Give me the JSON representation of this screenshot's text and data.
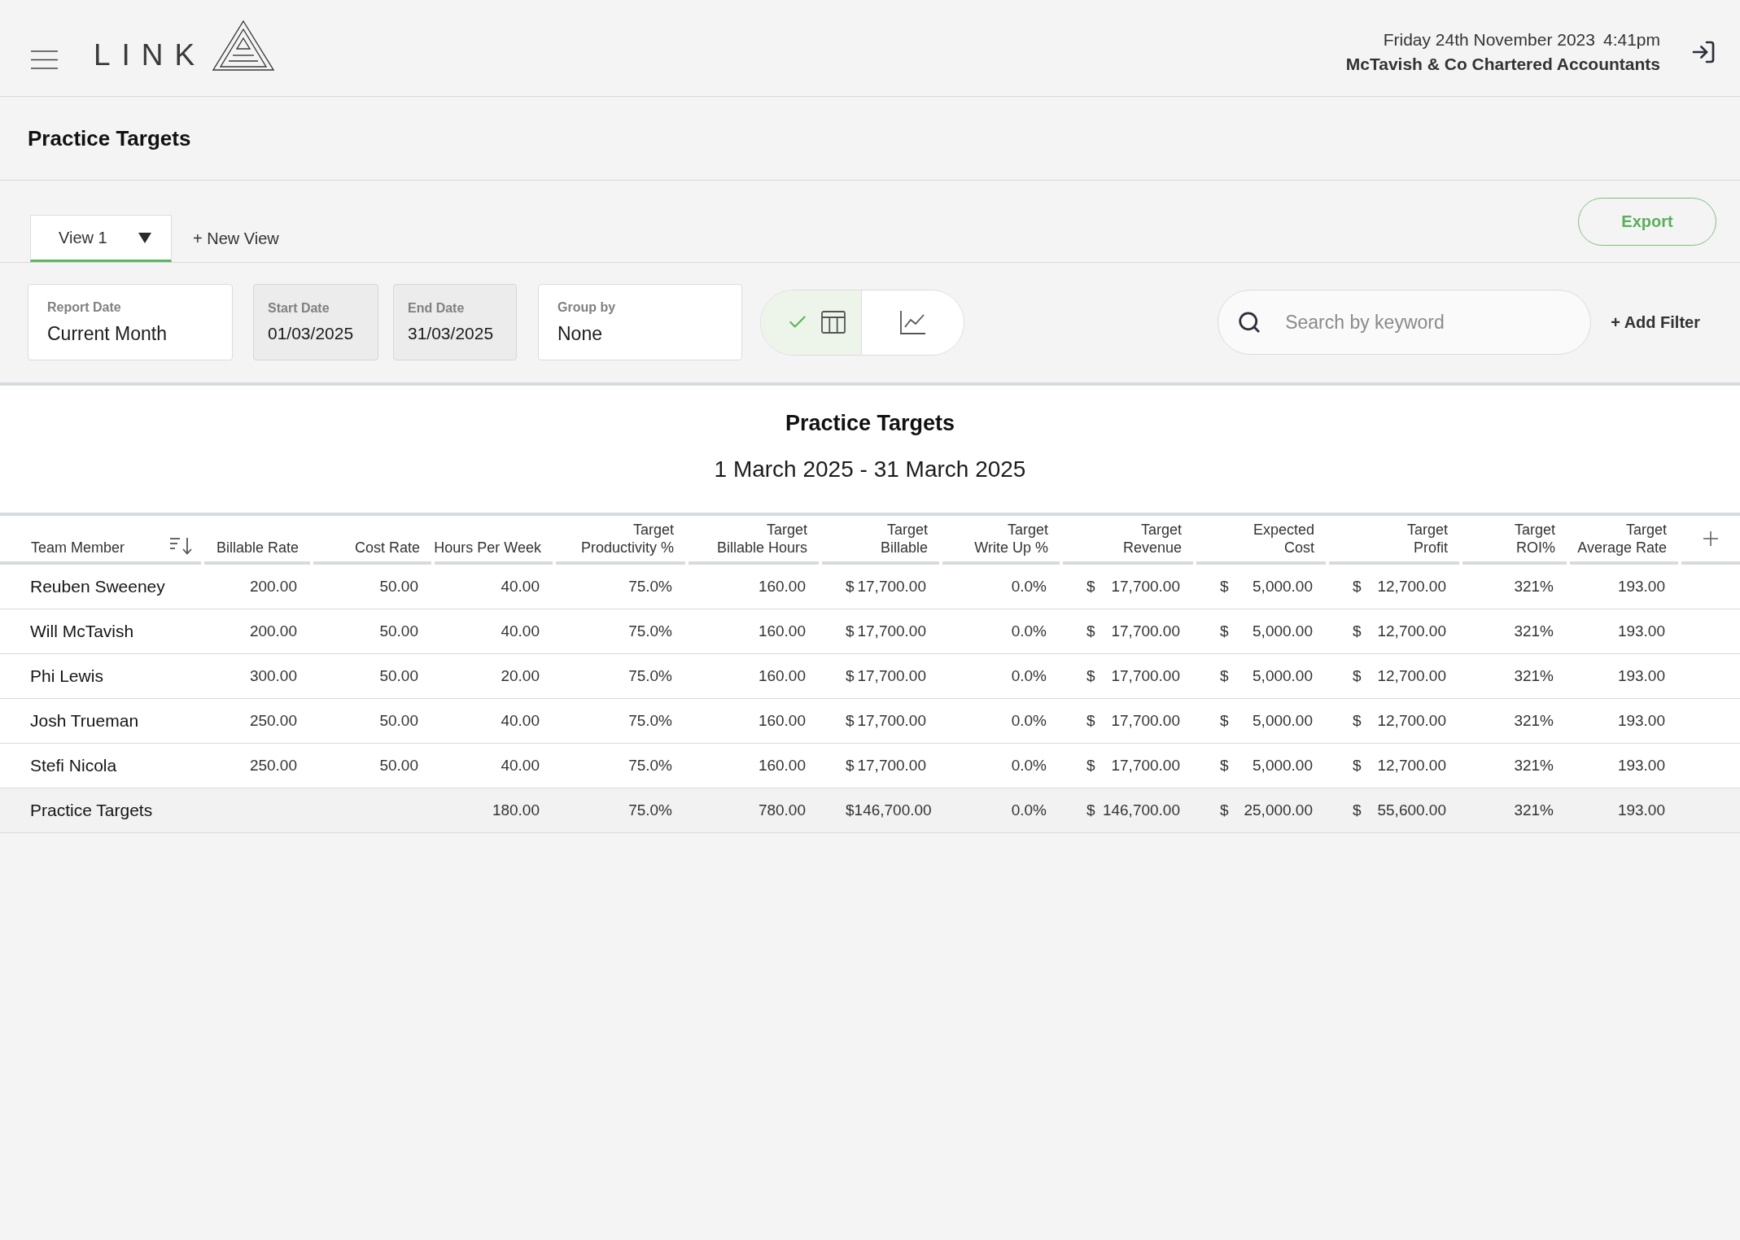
{
  "header": {
    "logo_text": "LINK",
    "date": "Friday 24th November 2023",
    "time": "4:41pm",
    "company": "McTavish & Co Chartered Accountants"
  },
  "page_title": "Practice Targets",
  "tabs": [
    {
      "label": "View 1",
      "selected": true
    }
  ],
  "new_view_button": "+ New View",
  "export_button": "Export",
  "filters": [
    {
      "label": "Report Date",
      "value": "Current Month",
      "disabled": false
    },
    {
      "label": "Start Date",
      "value": "01/03/2025",
      "disabled": true
    },
    {
      "label": "End Date",
      "value": "31/03/2025",
      "disabled": true
    },
    {
      "label": "Group by",
      "value": "None",
      "disabled": false
    }
  ],
  "view_toggle": [
    {
      "kind": "table",
      "selected": true
    },
    {
      "kind": "chart",
      "selected": false
    }
  ],
  "search": {
    "placeholder": "Search by keyword"
  },
  "add_filter_button": "+ Add Filter",
  "report": {
    "title": "Practice Targets",
    "date_range": "1 March 2025 - 31 March 2025"
  },
  "table": {
    "columns": [
      {
        "lines": [
          "Team Member"
        ],
        "kind": "name",
        "sorted": true
      },
      {
        "lines": [
          "Billable Rate"
        ],
        "kind": "number",
        "sorted": false
      },
      {
        "lines": [
          "Cost Rate"
        ],
        "kind": "number",
        "sorted": false
      },
      {
        "lines": [
          "Hours Per Week"
        ],
        "kind": "number",
        "sorted": false
      },
      {
        "lines": [
          "Target",
          "Productivity %"
        ],
        "kind": "number",
        "sorted": false
      },
      {
        "lines": [
          "Target",
          "Billable Hours"
        ],
        "kind": "number",
        "sorted": false
      },
      {
        "lines": [
          "Target",
          "Billable"
        ],
        "kind": "currency",
        "sorted": false
      },
      {
        "lines": [
          "Target",
          "Write Up %"
        ],
        "kind": "number",
        "sorted": false
      },
      {
        "lines": [
          "Target",
          "Revenue"
        ],
        "kind": "currency",
        "sorted": false
      },
      {
        "lines": [
          "Expected",
          "Cost"
        ],
        "kind": "currency",
        "sorted": false
      },
      {
        "lines": [
          "Target",
          "Profit"
        ],
        "kind": "currency",
        "sorted": false
      },
      {
        "lines": [
          "Target",
          "ROI%"
        ],
        "kind": "number",
        "sorted": false
      },
      {
        "lines": [
          "Target",
          "Average Rate"
        ],
        "kind": "number",
        "sorted": false
      }
    ],
    "rows": [
      {
        "total": false,
        "cells": [
          "Reuben Sweeney",
          "200.00",
          "50.00",
          "40.00",
          "75.0%",
          "160.00",
          {
            "symbol": "$",
            "amount": "17,700.00"
          },
          "0.0%",
          {
            "symbol": "$",
            "amount": "17,700.00"
          },
          {
            "symbol": "$",
            "amount": "5,000.00"
          },
          {
            "symbol": "$",
            "amount": "12,700.00"
          },
          "321%",
          "193.00"
        ]
      },
      {
        "total": false,
        "cells": [
          "Will McTavish",
          "200.00",
          "50.00",
          "40.00",
          "75.0%",
          "160.00",
          {
            "symbol": "$",
            "amount": "17,700.00"
          },
          "0.0%",
          {
            "symbol": "$",
            "amount": "17,700.00"
          },
          {
            "symbol": "$",
            "amount": "5,000.00"
          },
          {
            "symbol": "$",
            "amount": "12,700.00"
          },
          "321%",
          "193.00"
        ]
      },
      {
        "total": false,
        "cells": [
          "Phi Lewis",
          "300.00",
          "50.00",
          "20.00",
          "75.0%",
          "160.00",
          {
            "symbol": "$",
            "amount": "17,700.00"
          },
          "0.0%",
          {
            "symbol": "$",
            "amount": "17,700.00"
          },
          {
            "symbol": "$",
            "amount": "5,000.00"
          },
          {
            "symbol": "$",
            "amount": "12,700.00"
          },
          "321%",
          "193.00"
        ]
      },
      {
        "total": false,
        "cells": [
          "Josh Trueman",
          "250.00",
          "50.00",
          "40.00",
          "75.0%",
          "160.00",
          {
            "symbol": "$",
            "amount": "17,700.00"
          },
          "0.0%",
          {
            "symbol": "$",
            "amount": "17,700.00"
          },
          {
            "symbol": "$",
            "amount": "5,000.00"
          },
          {
            "symbol": "$",
            "amount": "12,700.00"
          },
          "321%",
          "193.00"
        ]
      },
      {
        "total": false,
        "cells": [
          "Stefi Nicola",
          "250.00",
          "50.00",
          "40.00",
          "75.0%",
          "160.00",
          {
            "symbol": "$",
            "amount": "17,700.00"
          },
          "0.0%",
          {
            "symbol": "$",
            "amount": "17,700.00"
          },
          {
            "symbol": "$",
            "amount": "5,000.00"
          },
          {
            "symbol": "$",
            "amount": "12,700.00"
          },
          "321%",
          "193.00"
        ]
      },
      {
        "total": true,
        "cells": [
          "Practice Targets",
          null,
          null,
          "180.00",
          "75.0%",
          "780.00",
          {
            "symbol": "$",
            "amount": "146,700.00"
          },
          "0.0%",
          {
            "symbol": "$",
            "amount": "146,700.00"
          },
          {
            "symbol": "$",
            "amount": "25,000.00"
          },
          {
            "symbol": "$",
            "amount": "55,600.00"
          },
          "321%",
          "193.00"
        ]
      }
    ]
  }
}
